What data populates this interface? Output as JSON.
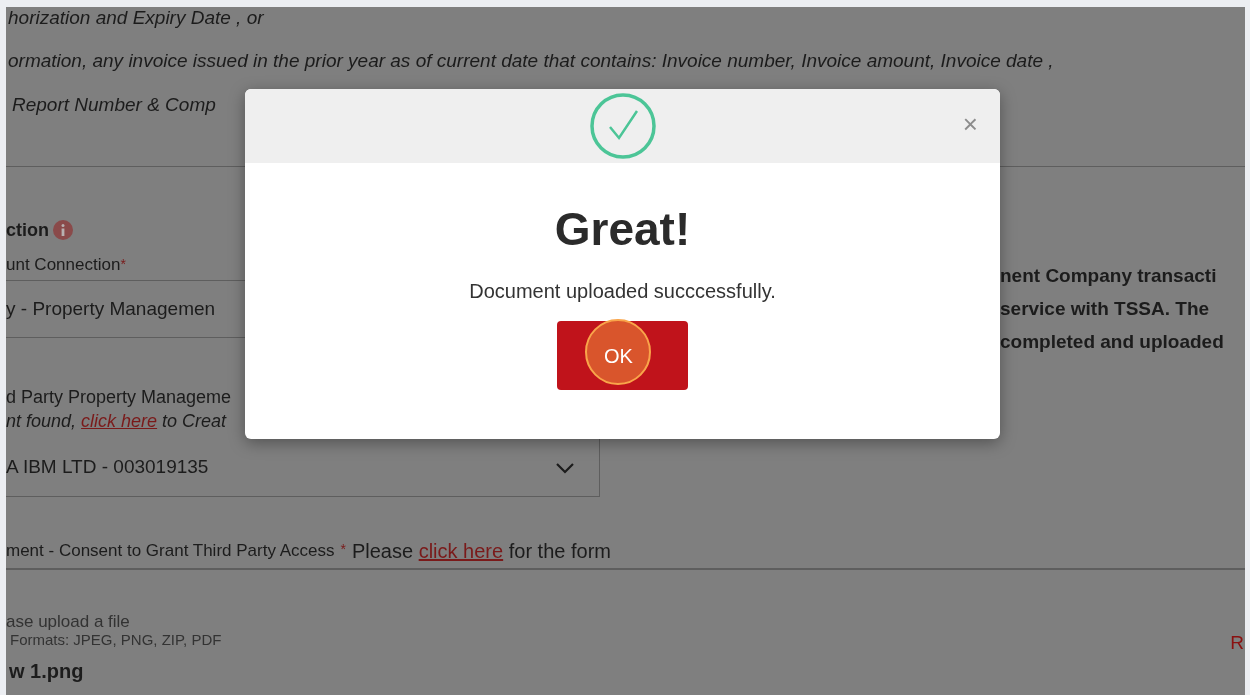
{
  "background_page": {
    "intro_lines": [
      "horization and Expiry Date , or",
      "ormation, any invoice issued in the prior year as of current date that contains: Invoice number, Invoice amount, Invoice date ,",
      "Report Number & Comp"
    ],
    "section_title": "ction",
    "account_connection": {
      "label": "unt Connection",
      "required_mark": "*",
      "value": "y - Property Managemen"
    },
    "third_party": {
      "label": "d Party Property Manageme",
      "note_before": "nt found, ",
      "note_link": "click here",
      "note_after": " to Creat",
      "value": "A IBM LTD - 003019135"
    },
    "consent": {
      "label": "ment - Consent to Grant Third Party Access",
      "required_mark": "*",
      "before": "Please",
      "link": "click here",
      "after": "for the form"
    },
    "upload": {
      "prompt": "ase upload a file",
      "formats": "Formats: JPEG, PNG, ZIP, PDF",
      "file_name": "w 1.png",
      "side_link": "R"
    },
    "right_text": [
      "nent Company transacti",
      "service with TSSA. The",
      "completed and uploaded"
    ]
  },
  "dialog": {
    "title": "Great!",
    "message": "Document uploaded succcessfully.",
    "ok_button": "OK",
    "close": "×"
  }
}
